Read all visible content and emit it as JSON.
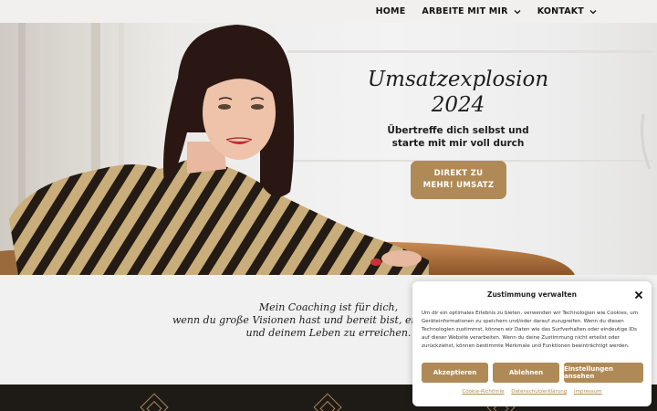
{
  "nav": {
    "items": [
      {
        "label": "HOME",
        "has_dropdown": false
      },
      {
        "label": "ARBEITE MIT MIR",
        "has_dropdown": true
      },
      {
        "label": "KONTAKT",
        "has_dropdown": true
      }
    ]
  },
  "hero": {
    "title_line1": "Umsatzexplosion",
    "title_line2": "2024",
    "subtitle_line1": "Übertreffe dich selbst und",
    "subtitle_line2": "starte mit mir voll durch",
    "cta_line1": "DIREKT ZU",
    "cta_line2": "MEHR! UMSATZ"
  },
  "intro": {
    "text": "Mein Coaching ist für dich,\nwenn du große Visionen hast und bereit bist, eine neue Dime\nund deinem Leben zu erreichen."
  },
  "consent": {
    "title": "Zustimmung verwalten",
    "body": "Um dir ein optimales Erlebnis zu bieten, verwenden wir Technologien wie Cookies, um Geräteinformationen zu speichern und/oder darauf zuzugreifen. Wenn du diesen Technologien zustimmst, können wir Daten wie das Surfverhalten oder eindeutige IDs auf dieser Website verarbeiten. Wenn du deine Zustimmung nicht erteilst oder zurückziehst, können bestimmte Merkmale und Funktionen beeinträchtigt werden.",
    "accept_label": "Akzeptieren",
    "decline_label": "Ablehnen",
    "settings_label": "Einstellungen ansehen",
    "links": [
      "Cookie-Richtlinie",
      "Datenschutzerklärung",
      "Impressum"
    ]
  },
  "colors": {
    "accent": "#b08a56",
    "dark_strip": "#1e1b17"
  },
  "icons": {
    "close": "close-icon",
    "chevron": "chevron-down-icon"
  }
}
